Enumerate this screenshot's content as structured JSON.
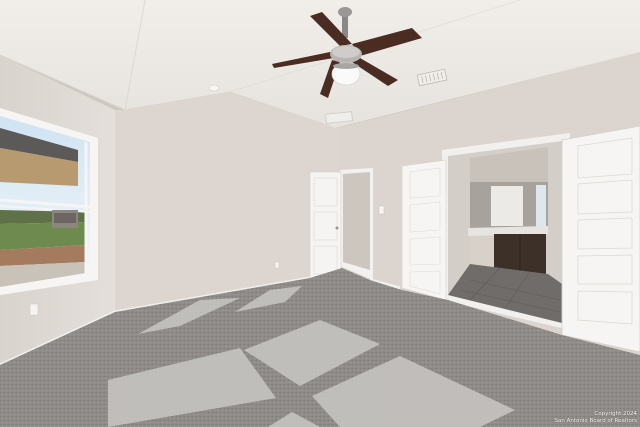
{
  "watermark": {
    "line1": "Copyright 2024",
    "line2": "San Antonio Board of Realtors"
  },
  "colors": {
    "ceiling": "#ece9e5",
    "wall_left": "#e1dbd6",
    "wall_back": "#d8d1cb",
    "wall_right": "#ddd6d0",
    "carpet": "#8e8b88",
    "door": "#f4f3f1",
    "fan_blade": "#4a2c22",
    "vanity": "#3d3029",
    "bath_floor": "#6f6c69"
  }
}
